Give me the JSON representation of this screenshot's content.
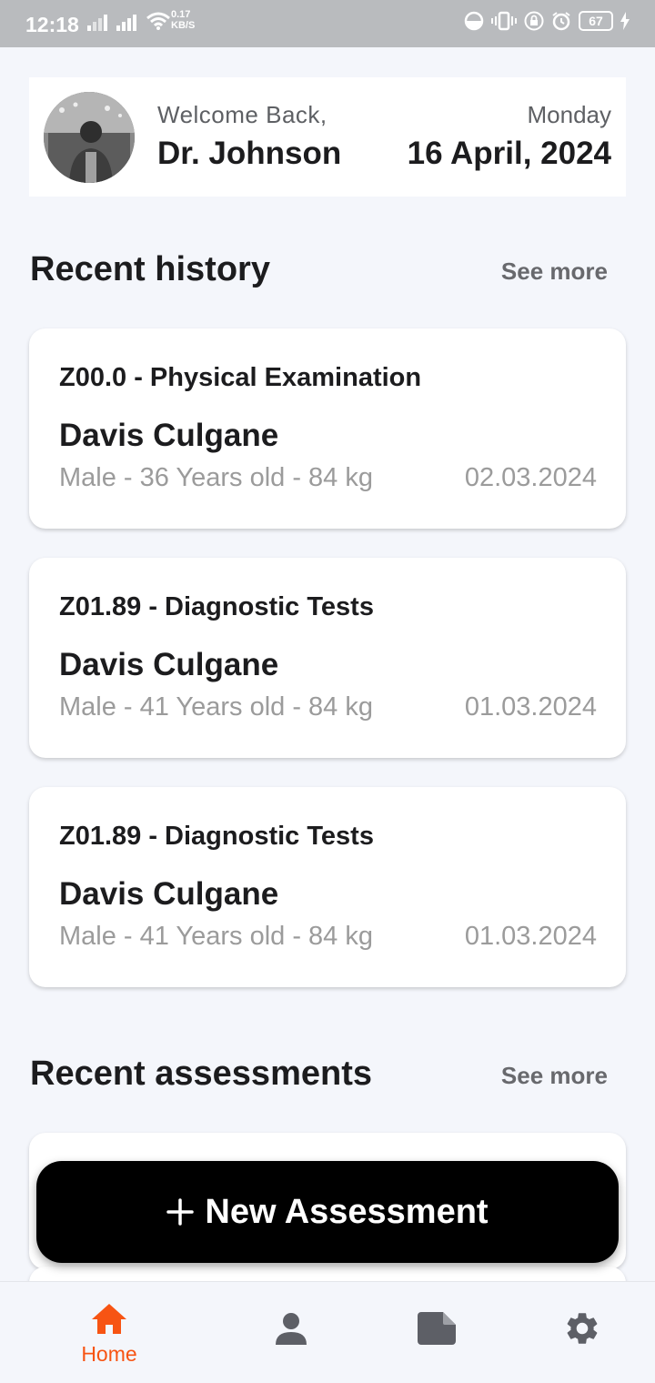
{
  "status_bar": {
    "time": "12:18",
    "speed_value": "0.17",
    "speed_unit": "KB/S",
    "battery": "67"
  },
  "header": {
    "welcome": "Welcome Back,",
    "doctor_name": "Dr. Johnson",
    "weekday": "Monday",
    "date": "16 April, 2024"
  },
  "recent_history": {
    "title": "Recent history",
    "see_more": "See more",
    "items": [
      {
        "code": "Z00.0 - Physical Examination",
        "patient": "Davis Culgane",
        "meta": "Male - 36 Years old - 84 kg",
        "date": "02.03.2024"
      },
      {
        "code": "Z01.89 - Diagnostic Tests",
        "patient": "Davis Culgane",
        "meta": "Male - 41 Years old - 84 kg",
        "date": "01.03.2024"
      },
      {
        "code": "Z01.89 - Diagnostic Tests",
        "patient": "Davis Culgane",
        "meta": "Male - 41 Years old - 84 kg",
        "date": "01.03.2024"
      }
    ]
  },
  "recent_assessments": {
    "title": "Recent assessments",
    "see_more": "See more"
  },
  "fab": {
    "label": "New Assessment",
    "icon": "plus-icon"
  },
  "bottom_nav": {
    "items": [
      {
        "label": "Home",
        "icon": "home-icon",
        "active": true
      },
      {
        "label": "",
        "icon": "person-icon",
        "active": false
      },
      {
        "label": "",
        "icon": "document-icon",
        "active": false
      },
      {
        "label": "",
        "icon": "gear-icon",
        "active": false
      }
    ]
  },
  "colors": {
    "accent": "#f75413",
    "background": "#f4f6fb",
    "card": "#ffffff",
    "fab": "#000000",
    "muted_text": "#9b9b9b",
    "inactive_icon": "#5d5f66"
  }
}
